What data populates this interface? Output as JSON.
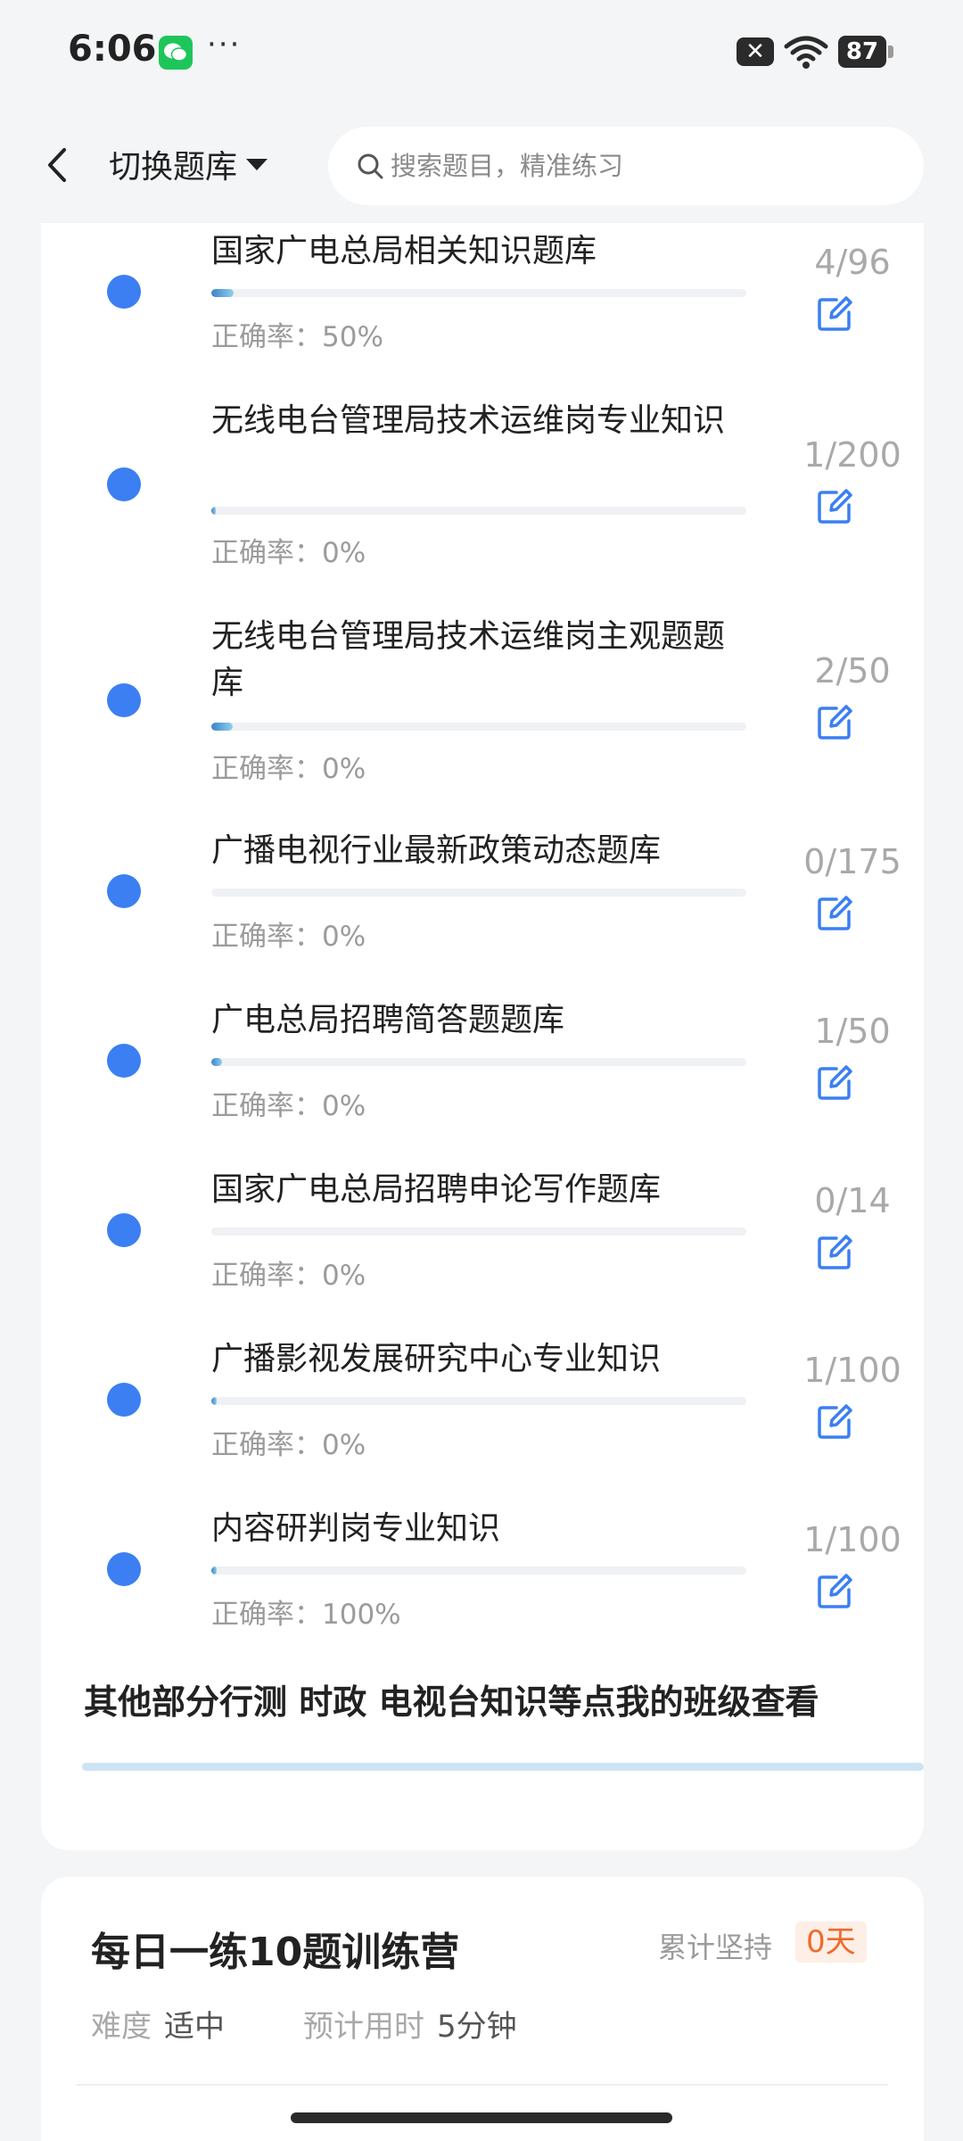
{
  "status_bar": {
    "time": "6:06",
    "more": "···",
    "x_badge": "✕",
    "battery": "87"
  },
  "header": {
    "switch_label": "切换题库",
    "search_placeholder": "搜索题目，精准练习"
  },
  "accuracy_prefix": "正确率：",
  "items": [
    {
      "title": "国家广电总局相关知识题库",
      "accuracy": "50%",
      "count": "4/96",
      "progress": 0.0417
    },
    {
      "title": "无线电台管理局技术运维岗专业知识",
      "accuracy": "0%",
      "count": "1/200",
      "progress": 0.005
    },
    {
      "title": "无线电台管理局技术运维岗主观题题库",
      "accuracy": "0%",
      "count": "2/50",
      "progress": 0.04
    },
    {
      "title": "广播电视行业最新政策动态题库",
      "accuracy": "0%",
      "count": "0/175",
      "progress": 0
    },
    {
      "title": "广电总局招聘简答题题库",
      "accuracy": "0%",
      "count": "1/50",
      "progress": 0.02
    },
    {
      "title": "国家广电总局招聘申论写作题库",
      "accuracy": "0%",
      "count": "0/14",
      "progress": 0
    },
    {
      "title": "广播影视发展研究中心专业知识",
      "accuracy": "0%",
      "count": "1/100",
      "progress": 0.01
    },
    {
      "title": "内容研判岗专业知识",
      "accuracy": "100%",
      "count": "1/100",
      "progress": 0.01
    }
  ],
  "class_link": "其他部分行测 时政 电视台知识等点我的班级查看",
  "training_camp": {
    "title": "每日一练10题训练营",
    "streak_label": "累计坚持",
    "streak_value": "0天",
    "difficulty_label": "难度",
    "difficulty_value": "适中",
    "time_label": "预计用时",
    "time_value": "5分钟"
  },
  "colors": {
    "accent_blue": "#3b7ff3",
    "streak_orange": "#ef6a2c",
    "wechat_green": "#1ec65a"
  }
}
